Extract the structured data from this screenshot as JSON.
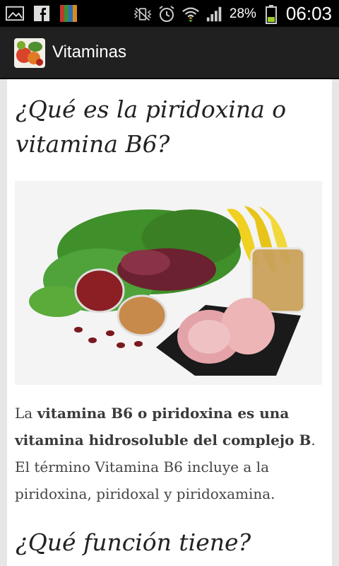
{
  "status_bar": {
    "battery_percent": "28%",
    "time": "06:03"
  },
  "action_bar": {
    "title": "Vitaminas"
  },
  "article": {
    "heading1": "¿Qué es la piridoxina o vitamina B6?",
    "paragraph": {
      "prefix": "La ",
      "bold": "vitamina B6 o piridoxina es una vitamina hidrosoluble del complejo B",
      "suffix": ". El término Vitamina B6 incluye a la piridoxina, piridoxal y piridoxamina."
    },
    "heading2": "¿Qué función tiene?"
  }
}
